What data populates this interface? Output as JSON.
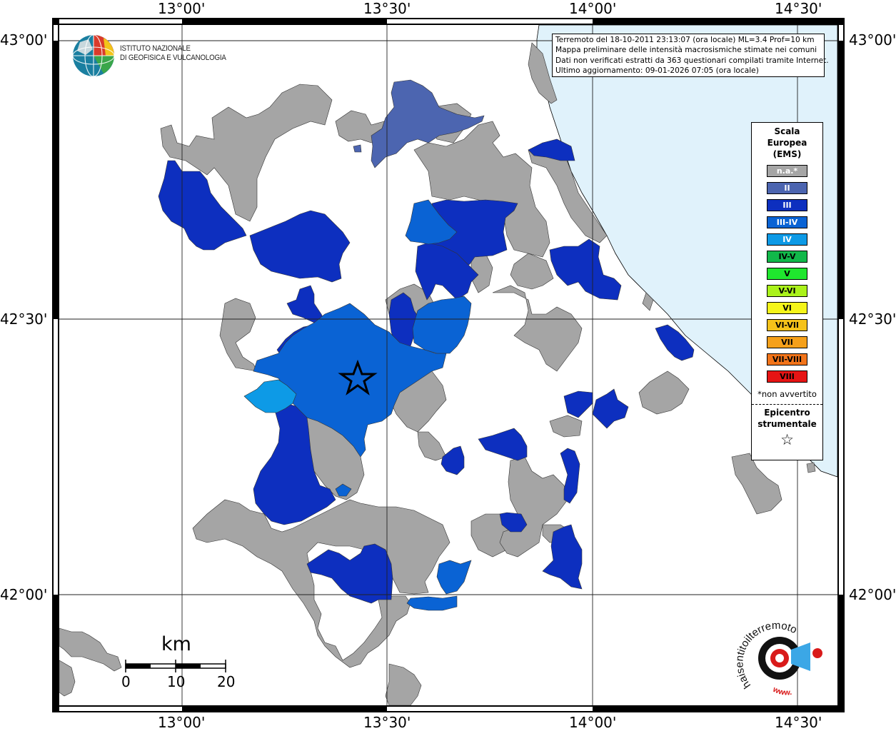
{
  "axes": {
    "lon_labels": [
      "13°00'",
      "13°30'",
      "14°00'",
      "14°30'"
    ],
    "lat_labels": [
      "43°00'",
      "42°30'",
      "42°00'"
    ]
  },
  "info_box": {
    "line1": "Terremoto del 18-10-2011 23:13:07 (ora locale) ML=3.4 Prof=10 km",
    "line2": "Mappa preliminare delle intensità macrosismiche stimate nei comuni",
    "line3": "Dati non verificati estratti da 363 questionari compilati tramite Internet.",
    "line4": "Ultimo aggiornamento: 09-01-2026 07:05 (ora locale)"
  },
  "legend": {
    "title": [
      "Scala",
      "Europea",
      "(EMS)"
    ],
    "items": [
      {
        "label": "n.a.*",
        "color": "#a5a5a5",
        "text_color": "#ffffff"
      },
      {
        "label": "II",
        "color": "#4c65b0",
        "text_color": "#ffffff"
      },
      {
        "label": "III",
        "color": "#0d2fbf",
        "text_color": "#ffffff"
      },
      {
        "label": "III-IV",
        "color": "#0a63d4",
        "text_color": "#ffffff"
      },
      {
        "label": "IV",
        "color": "#0d9ae6",
        "text_color": "#ffffff"
      },
      {
        "label": "IV-V",
        "color": "#12b84a",
        "text_color": "#000000"
      },
      {
        "label": "V",
        "color": "#1fe62e",
        "text_color": "#000000"
      },
      {
        "label": "V-VI",
        "color": "#aaf21a",
        "text_color": "#000000"
      },
      {
        "label": "VI",
        "color": "#f5f51a",
        "text_color": "#000000"
      },
      {
        "label": "VI-VII",
        "color": "#f5c21a",
        "text_color": "#000000"
      },
      {
        "label": "VII",
        "color": "#f5a01a",
        "text_color": "#000000"
      },
      {
        "label": "VII-VIII",
        "color": "#f2741a",
        "text_color": "#000000"
      },
      {
        "label": "VIII",
        "color": "#e61414",
        "text_color": "#000000"
      }
    ],
    "note": "*non avvertito",
    "epicenter_title": [
      "Epicentro",
      "strumentale"
    ],
    "epicenter_symbol": "☆"
  },
  "ingv": {
    "line1": "ISTITUTO NAZIONALE",
    "line2": "DI GEOFISICA E VULCANOLOGIA"
  },
  "scale_bar": {
    "unit": "km",
    "ticks": [
      "0",
      "10",
      "20"
    ]
  },
  "colors": {
    "sea": "#e0f2fb",
    "coast": "#000000",
    "not_felt": "#a5a5a5"
  },
  "hsit_logo": {
    "text": "haisentitoilterremoto.it",
    "www": "www.",
    "domain": "haisentitoilterremoto"
  }
}
